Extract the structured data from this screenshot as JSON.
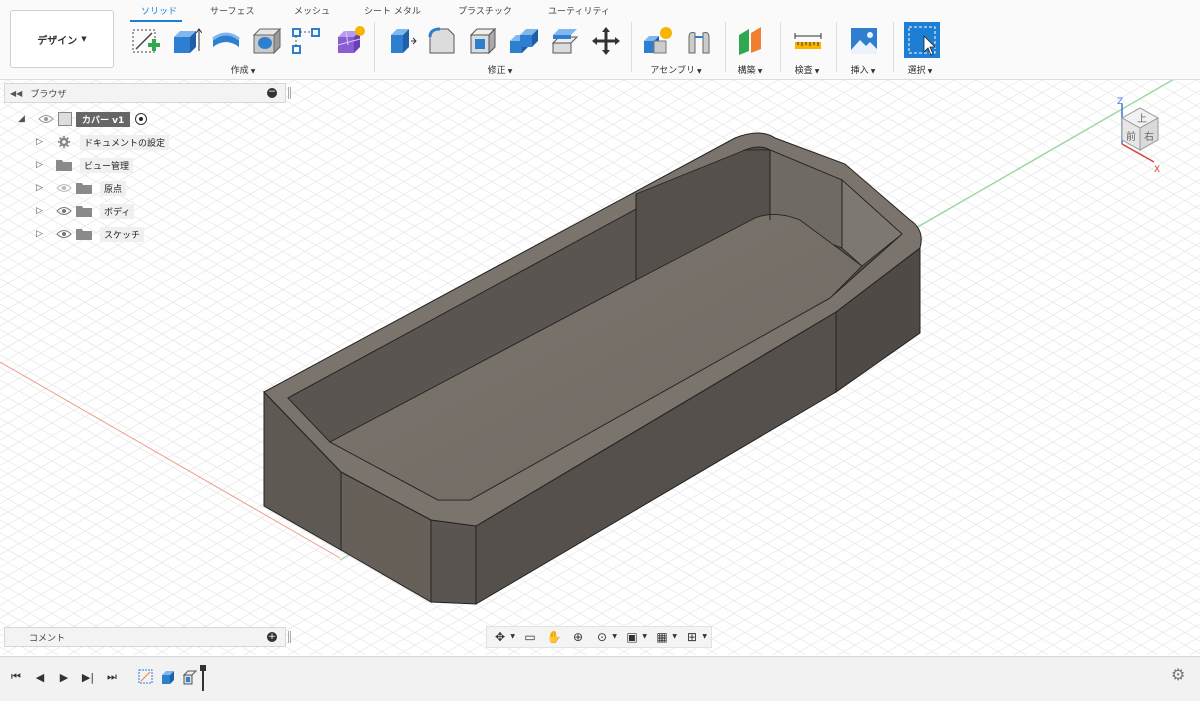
{
  "workspace": {
    "label": "デザイン"
  },
  "tabs": [
    {
      "label": "ソリッド",
      "active": true
    },
    {
      "label": "サーフェス",
      "active": false
    },
    {
      "label": "メッシュ",
      "active": false
    },
    {
      "label": "シート メタル",
      "active": false
    },
    {
      "label": "プラスチック",
      "active": false
    },
    {
      "label": "ユーティリティ",
      "active": false
    }
  ],
  "toolbar_groups": {
    "create": "作成",
    "modify": "修正",
    "assemble": "アセンブリ",
    "construct": "構築",
    "inspect": "検査",
    "insert": "挿入",
    "select": "選択"
  },
  "browser": {
    "title": "ブラウザ",
    "root": {
      "label": "カバー v1"
    },
    "items": [
      {
        "label": "ドキュメントの設定",
        "icon": "gear-icon"
      },
      {
        "label": "ビュー管理",
        "icon": "folder-icon"
      },
      {
        "label": "原点",
        "icon": "folder-icon",
        "visibility": "hidden"
      },
      {
        "label": "ボディ",
        "icon": "folder-icon",
        "visibility": "visible"
      },
      {
        "label": "スケッチ",
        "icon": "folder-icon",
        "visibility": "visible"
      }
    ]
  },
  "comments": {
    "title": "コメント"
  },
  "viewcube": {
    "top": "上",
    "front": "前",
    "right": "右",
    "axis_z": "Z",
    "axis_x": "X"
  },
  "navbar": {
    "tools": [
      "orbit-icon",
      "look-at-icon",
      "pan-icon",
      "zoom-icon",
      "fit-icon",
      "display-settings-icon",
      "grid-settings-icon",
      "viewports-icon"
    ]
  },
  "timeline": {
    "controls": [
      "go-to-start",
      "step-back",
      "play",
      "step-forward",
      "go-to-end"
    ]
  },
  "colors": {
    "accent": "#1d7ed6",
    "model_top": "#7a736c",
    "model_side": "#5b5650",
    "model_inner": "#6a645e"
  }
}
